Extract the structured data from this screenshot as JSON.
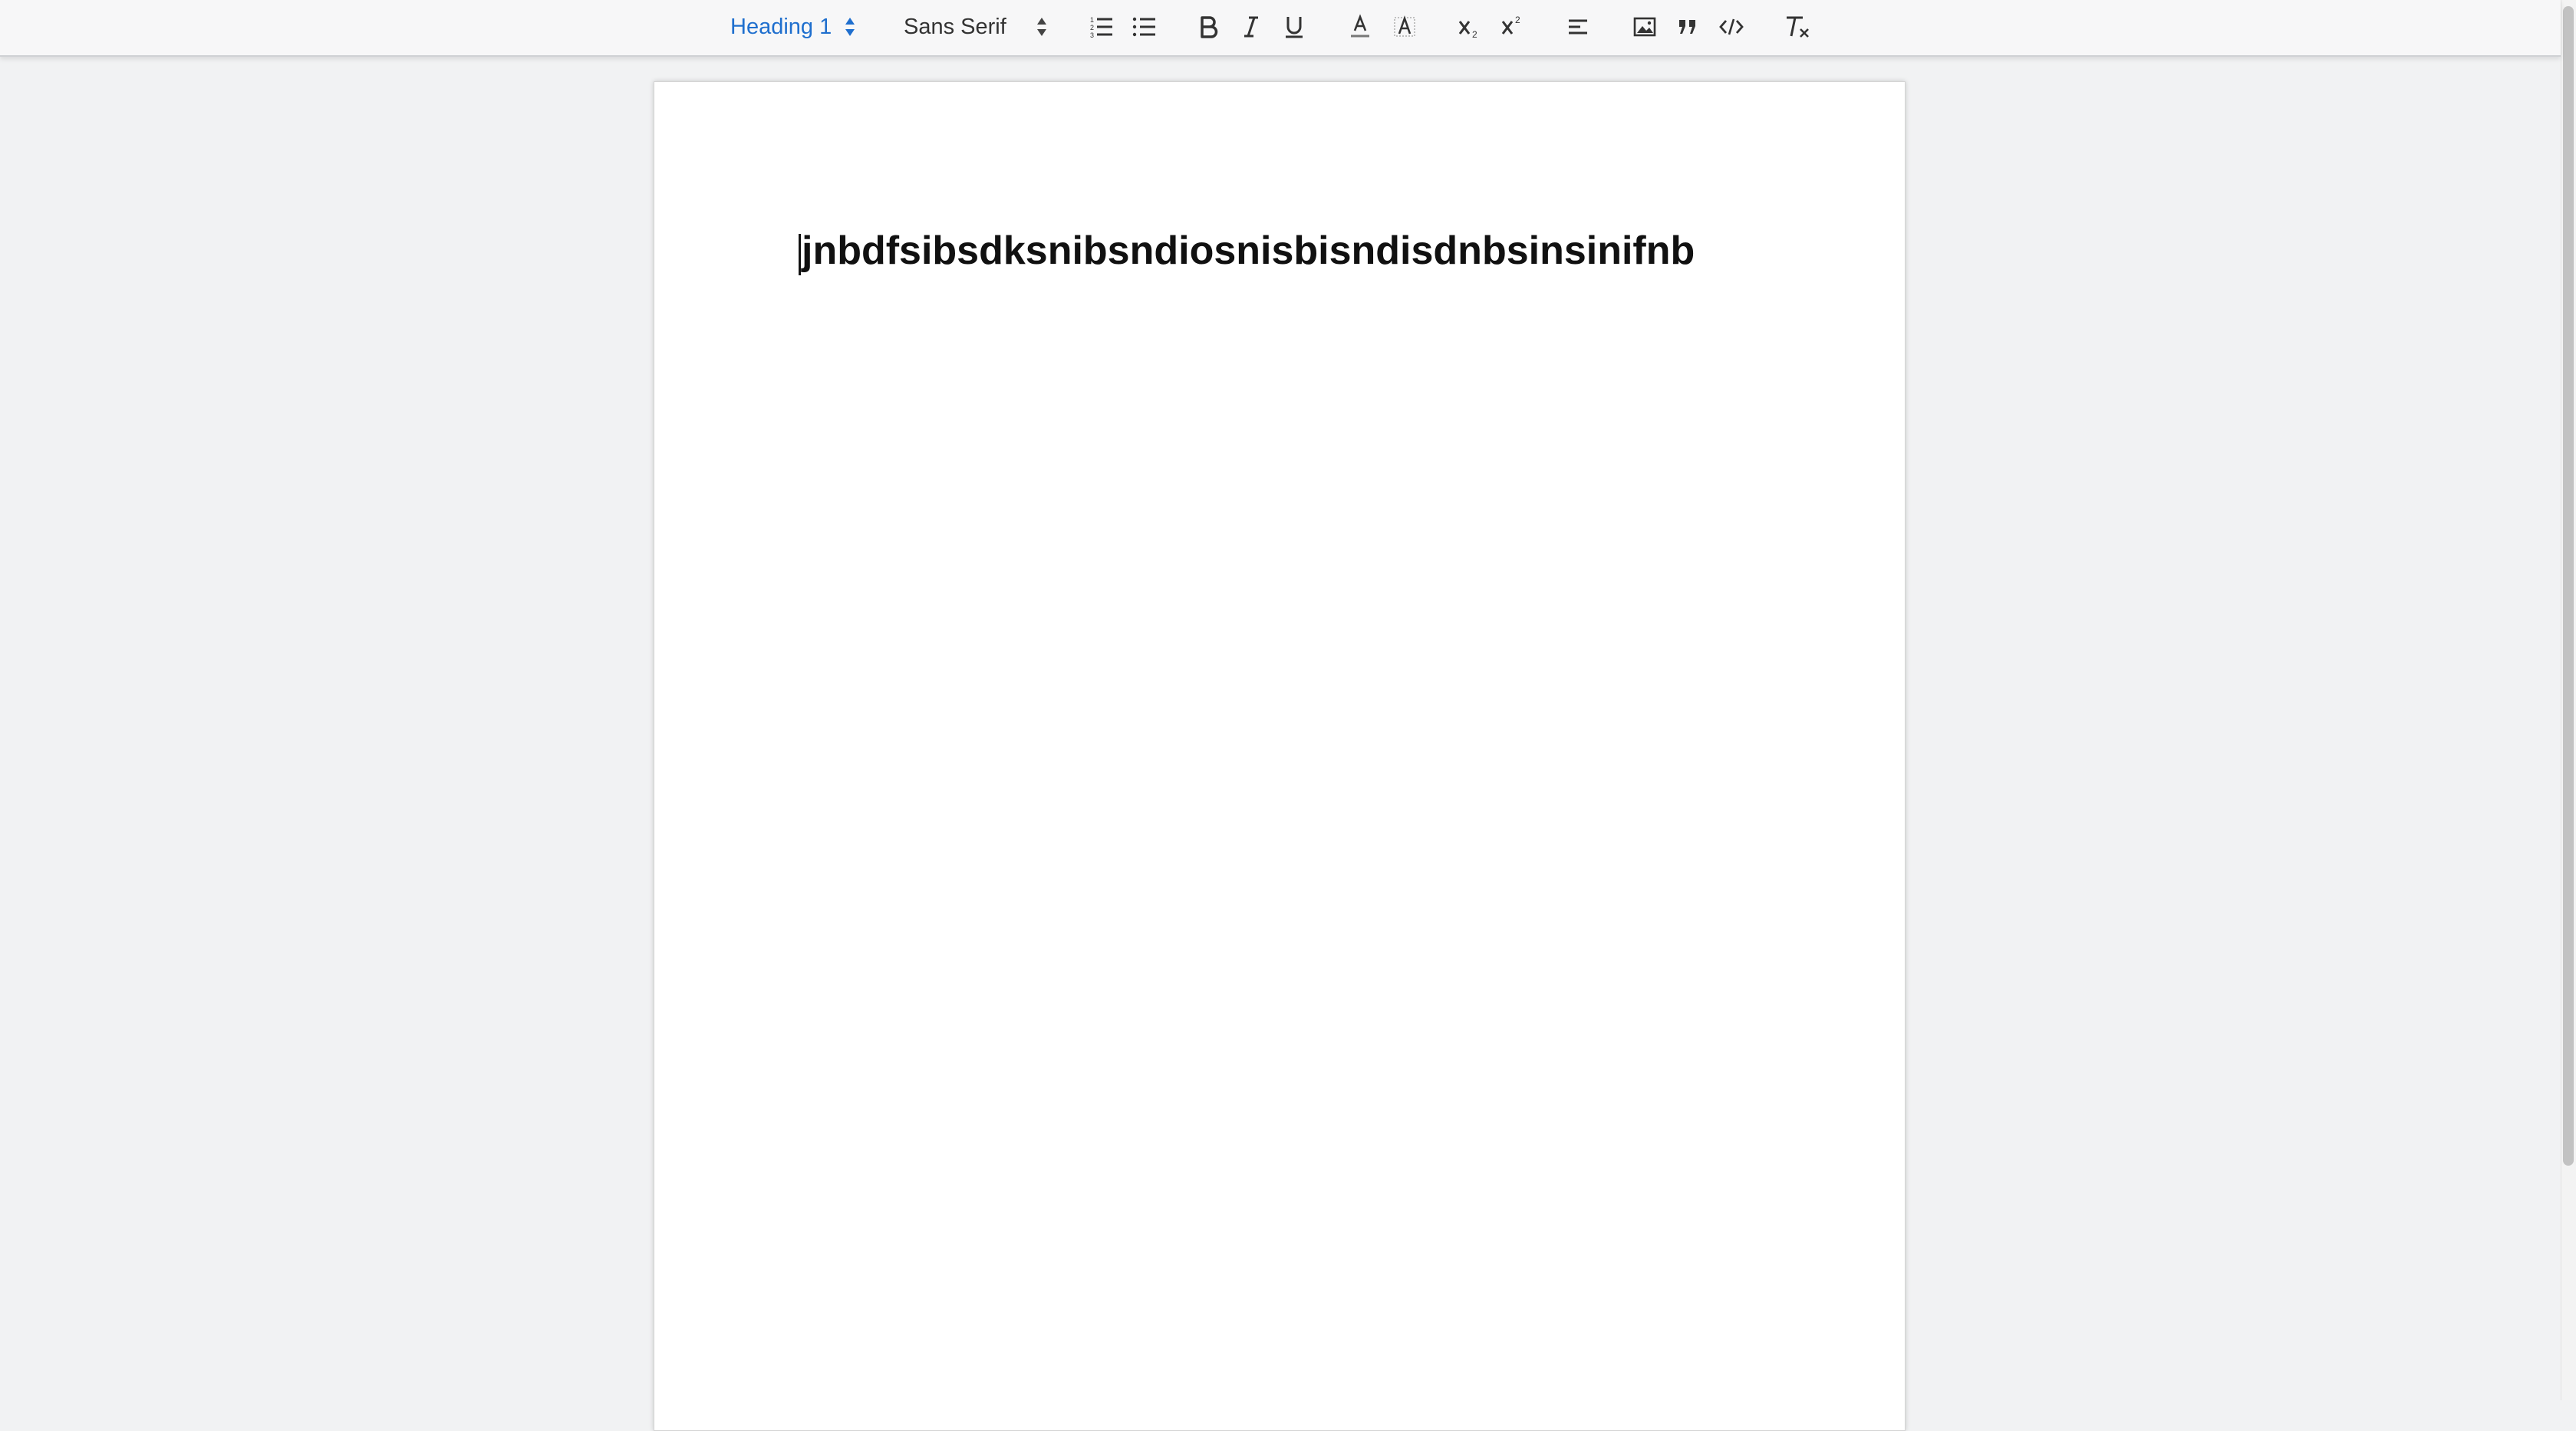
{
  "toolbar": {
    "heading_picker": {
      "value": "Heading 1",
      "color": "#1f6fce"
    },
    "font_picker": {
      "value": "Sans Serif"
    },
    "buttons": [
      {
        "name": "ordered-list",
        "icon": "ordered-list-icon"
      },
      {
        "name": "bullet-list",
        "icon": "bullet-list-icon"
      },
      {
        "name": "bold",
        "icon": "bold-icon"
      },
      {
        "name": "italic",
        "icon": "italic-icon"
      },
      {
        "name": "underline",
        "icon": "underline-icon"
      },
      {
        "name": "text-color",
        "icon": "text-color-icon"
      },
      {
        "name": "background-color",
        "icon": "highlight-icon"
      },
      {
        "name": "subscript",
        "icon": "subscript-icon"
      },
      {
        "name": "superscript",
        "icon": "superscript-icon"
      },
      {
        "name": "align",
        "icon": "align-left-icon"
      },
      {
        "name": "image",
        "icon": "image-icon"
      },
      {
        "name": "blockquote",
        "icon": "blockquote-icon"
      },
      {
        "name": "code-block",
        "icon": "code-icon"
      },
      {
        "name": "clear-formatting",
        "icon": "clear-formatting-icon"
      }
    ]
  },
  "document": {
    "heading_text": "jnbdfsibsdksnibsndiosnisbisndisdnbsinsinifnb"
  },
  "colors": {
    "accent": "#1f6fce",
    "icon": "#333333",
    "page_background": "#ffffff",
    "workspace_background": "#f1f2f3"
  }
}
